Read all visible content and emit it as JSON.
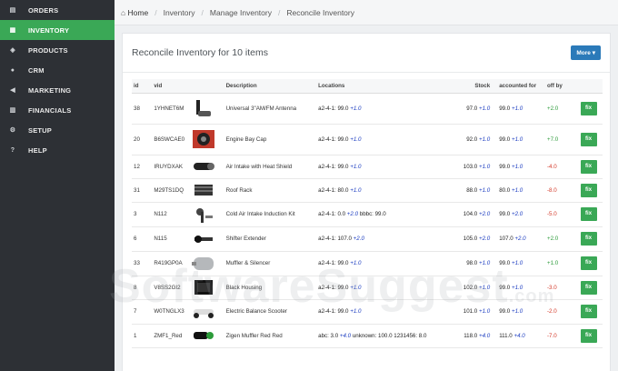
{
  "sidebar": {
    "items": [
      {
        "label": "ORDERS",
        "icon": "cart-icon",
        "glyph": "▤"
      },
      {
        "label": "INVENTORY",
        "icon": "cubes-icon",
        "glyph": "▦"
      },
      {
        "label": "PRODUCTS",
        "icon": "tags-icon",
        "glyph": "◈"
      },
      {
        "label": "CRM",
        "icon": "users-icon",
        "glyph": "●"
      },
      {
        "label": "MARKETING",
        "icon": "bullhorn-icon",
        "glyph": "◀"
      },
      {
        "label": "FINANCIALS",
        "icon": "bar-chart-icon",
        "glyph": "▥"
      },
      {
        "label": "SETUP",
        "icon": "gear-icon",
        "glyph": "⚙"
      },
      {
        "label": "HELP",
        "icon": "question-icon",
        "glyph": "?"
      }
    ],
    "active_index": 1
  },
  "breadcrumb": {
    "home": "Home",
    "items": [
      "Inventory",
      "Manage Inventory",
      "Reconcile Inventory"
    ]
  },
  "panel": {
    "title": "Reconcile Inventory for 10 items",
    "more_label": "More ▾"
  },
  "table": {
    "headers": [
      "id",
      "vid",
      "",
      "Description",
      "Locations",
      "Stock",
      "accounted for",
      "off by",
      ""
    ],
    "fix_label": "fix",
    "rows": [
      {
        "id": "38",
        "vid": "1YHNET6M",
        "desc": "Universal 3\"AM/FM Antenna",
        "loc": "a2-4-1: 99.0",
        "loc_up": "+1.0",
        "loc_extra": "",
        "stock": "97.0",
        "stock_up": "+1.0",
        "acct": "99.0",
        "acct_up": "+1.0",
        "off": "+2.0",
        "off_sign": "pos"
      },
      {
        "id": "20",
        "vid": "B6SWCAE0",
        "desc": "Engine Bay Cap",
        "loc": "a2-4-1: 99.0",
        "loc_up": "+1.0",
        "loc_extra": "",
        "stock": "92.0",
        "stock_up": "+1.0",
        "acct": "99.0",
        "acct_up": "+1.0",
        "off": "+7.0",
        "off_sign": "pos"
      },
      {
        "id": "12",
        "vid": "IRUYDXAK",
        "desc": "Air Intake with Heat Shield",
        "loc": "a2-4-1: 99.0",
        "loc_up": "+1.0",
        "loc_extra": "",
        "stock": "103.0",
        "stock_up": "+1.0",
        "acct": "99.0",
        "acct_up": "+1.0",
        "off": "-4.0",
        "off_sign": "neg"
      },
      {
        "id": "31",
        "vid": "M29TS1DQ",
        "desc": "Roof Rack",
        "loc": "a2-4-1: 80.0",
        "loc_up": "+1.0",
        "loc_extra": "",
        "stock": "88.0",
        "stock_up": "+1.0",
        "acct": "80.0",
        "acct_up": "+1.0",
        "off": "-8.0",
        "off_sign": "neg"
      },
      {
        "id": "3",
        "vid": "N112",
        "desc": "Cold Air Intake Induction Kit",
        "loc": "a2-4-1: 0.0",
        "loc_up": "+2.0",
        "loc_extra": "bbbc: 99.0",
        "stock": "104.0",
        "stock_up": "+2.0",
        "acct": "99.0",
        "acct_up": "+2.0",
        "off": "-5.0",
        "off_sign": "neg"
      },
      {
        "id": "6",
        "vid": "N115",
        "desc": "Shifter Extender",
        "loc": "a2-4-1: 107.0",
        "loc_up": "+2.0",
        "loc_extra": "",
        "stock": "105.0",
        "stock_up": "+2.0",
        "acct": "107.0",
        "acct_up": "+2.0",
        "off": "+2.0",
        "off_sign": "pos"
      },
      {
        "id": "33",
        "vid": "R419GP0A",
        "desc": "Muffler & Silencer",
        "loc": "a2-4-1: 99.0",
        "loc_up": "+1.0",
        "loc_extra": "",
        "stock": "98.0",
        "stock_up": "+1.0",
        "acct": "99.0",
        "acct_up": "+1.0",
        "off": "+1.0",
        "off_sign": "pos"
      },
      {
        "id": "8",
        "vid": "V8SS2GI2",
        "desc": "Black Housing",
        "loc": "a2-4-1: 99.0",
        "loc_up": "+1.0",
        "loc_extra": "",
        "stock": "102.0",
        "stock_up": "+1.0",
        "acct": "99.0",
        "acct_up": "+1.0",
        "off": "-3.0",
        "off_sign": "neg"
      },
      {
        "id": "7",
        "vid": "W0TNGLX3",
        "desc": "Electric Balance Scooter",
        "loc": "a2-4-1: 99.0",
        "loc_up": "+1.0",
        "loc_extra": "",
        "stock": "101.0",
        "stock_up": "+1.0",
        "acct": "99.0",
        "acct_up": "+1.0",
        "off": "-2.0",
        "off_sign": "neg"
      },
      {
        "id": "1",
        "vid": "ZMF1_Red",
        "desc": "Zigen Muffler Red Red",
        "loc": "abc: 3.0",
        "loc_up": "+4.0",
        "loc_extra": "unknown: 100.0  1231456: 8.0",
        "stock": "118.0",
        "stock_up": "+4.0",
        "acct": "111.0",
        "acct_up": "+4.0",
        "off": "-7.0",
        "off_sign": "neg"
      }
    ]
  },
  "watermark": {
    "text": "SoftwareSuggest",
    "domain": ".com"
  },
  "colors": {
    "sidebar": "#2d3035",
    "accent": "#3aa856",
    "button": "#2b7ab9",
    "positive": "#2c9b3a",
    "negative": "#d43a2a",
    "increment": "#1a3bc0"
  }
}
